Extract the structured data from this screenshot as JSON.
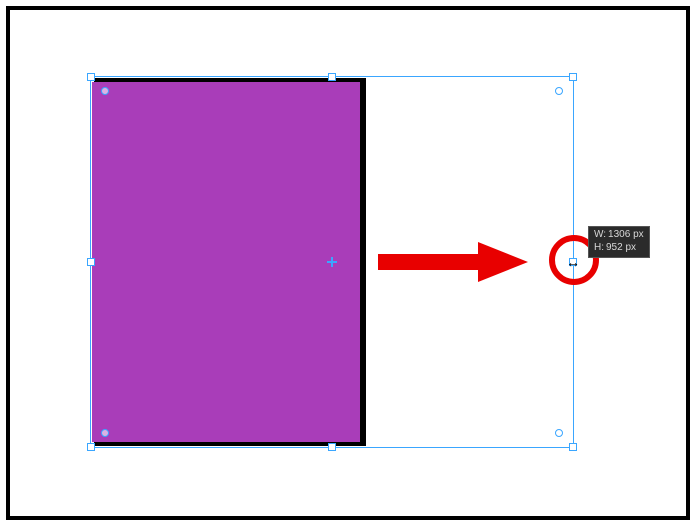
{
  "tooltip": {
    "w_label": "W:",
    "w_value": "1306 px",
    "h_label": "H:",
    "h_value": "952 px"
  },
  "shape": {
    "fill": "#a93db9"
  },
  "annotation": {
    "arrow_color": "#e80000",
    "circle_color": "#e80000"
  },
  "icons": {
    "resize_horizontal": "↔"
  }
}
